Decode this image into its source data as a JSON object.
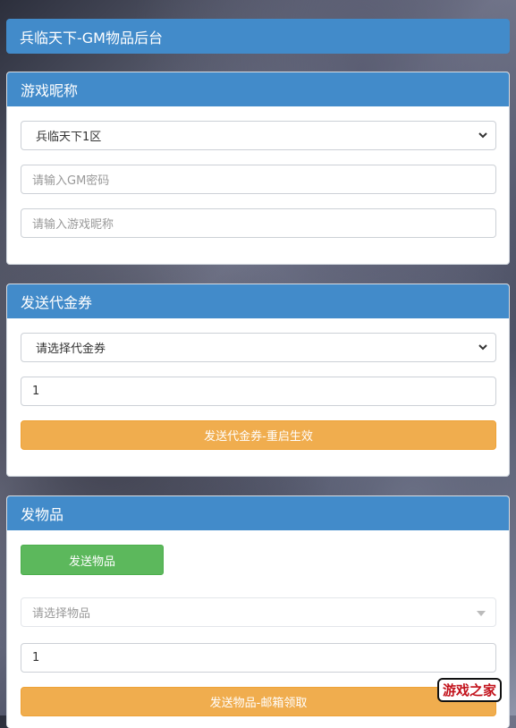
{
  "header": {
    "title": "兵临天下-GM物品后台"
  },
  "nickname_panel": {
    "title": "游戏昵称",
    "server_select": "兵临天下1区",
    "gm_password_placeholder": "请输入GM密码",
    "nickname_placeholder": "请输入游戏昵称"
  },
  "voucher_panel": {
    "title": "发送代金券",
    "voucher_select": "请选择代金券",
    "amount_value": "1",
    "send_button": "发送代金券-重启生效"
  },
  "item_panel": {
    "title": "发物品",
    "send_items_button": "发送物品",
    "item_select_placeholder": "请选择物品",
    "quantity_value": "1",
    "send_mail_button": "发送物品-邮箱领取"
  },
  "watermark": {
    "logo_text": "游戏之家"
  },
  "colors": {
    "header_blue": "#428bca",
    "button_orange": "#f0ad4e",
    "button_green": "#5cb85c"
  }
}
